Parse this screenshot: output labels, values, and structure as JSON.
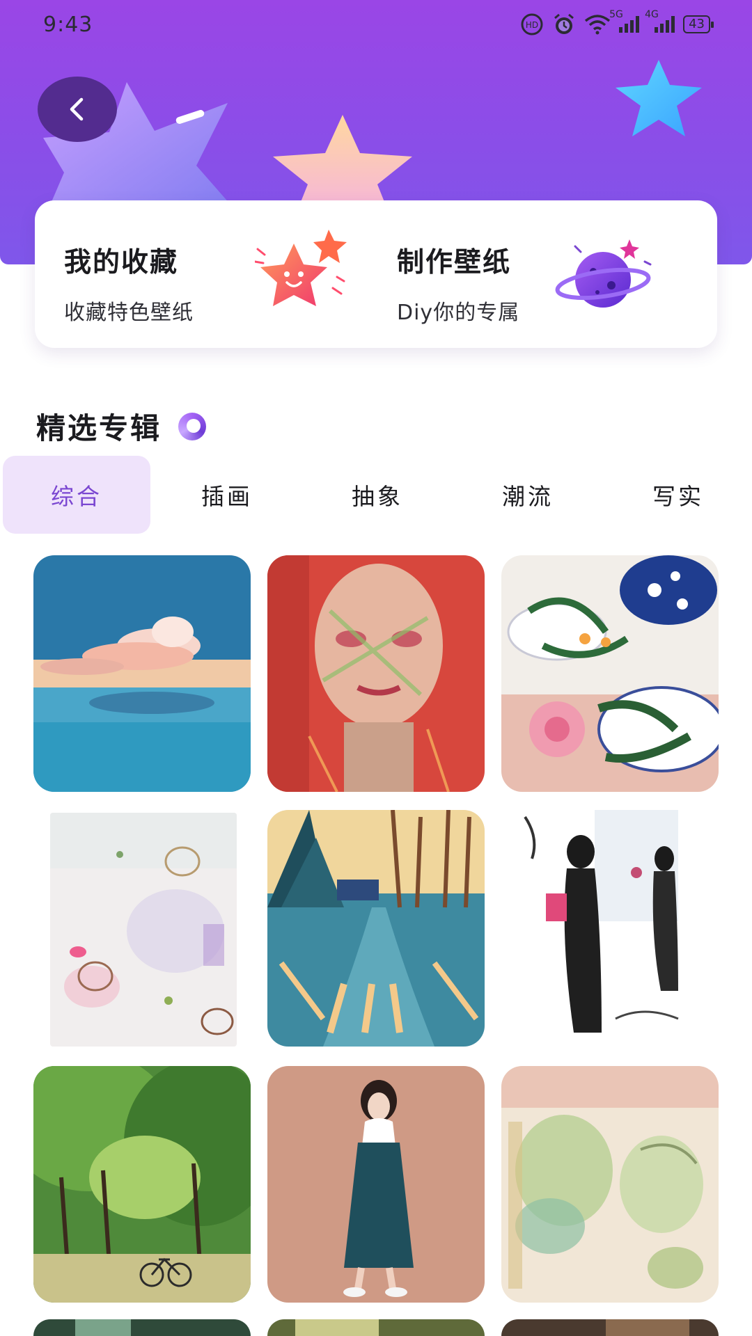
{
  "status_bar": {
    "time": "9:43",
    "hd_label": "HD",
    "signal_1_label": "5G",
    "signal_2_label": "4G",
    "battery": "43"
  },
  "header": {
    "back_icon": "chevron-left-icon",
    "gradient_top": "#9a46e6",
    "gradient_bottom": "#7f57ea"
  },
  "features": [
    {
      "title": "我的收藏",
      "subtitle": "收藏特色壁纸",
      "icon": "smiling-star-icon"
    },
    {
      "title": "制作壁纸",
      "subtitle": "Diy你的专属",
      "icon": "planet-icon"
    }
  ],
  "section": {
    "title": "精选专辑"
  },
  "tabs": [
    {
      "label": "综合",
      "active": true
    },
    {
      "label": "插画",
      "active": false
    },
    {
      "label": "抽象",
      "active": false
    },
    {
      "label": "潮流",
      "active": false
    },
    {
      "label": "写实",
      "active": false
    }
  ],
  "accent_color": "#7a46d1",
  "wallpapers": [
    {
      "subject": "whale-sky-painting"
    },
    {
      "subject": "painted-face-portrait"
    },
    {
      "subject": "porcelain-flower-still-life"
    },
    {
      "subject": "abstract-watercolor-stains"
    },
    {
      "subject": "snowy-road-landscape"
    },
    {
      "subject": "ink-figure-sketch"
    },
    {
      "subject": "forest-bicycle-watercolor"
    },
    {
      "subject": "girl-in-dress-illustration"
    },
    {
      "subject": "abstract-green-wash"
    }
  ]
}
